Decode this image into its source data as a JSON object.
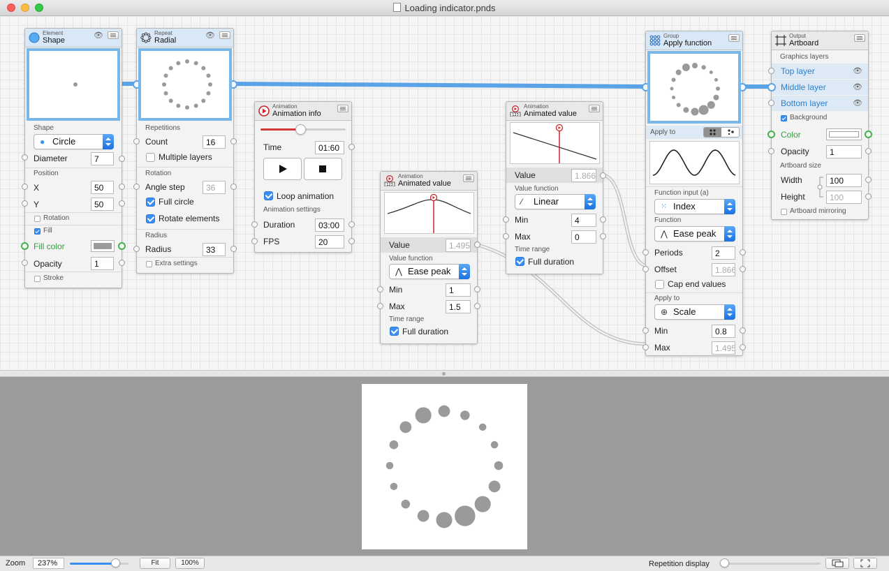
{
  "window": {
    "title": "Loading indicator.pnds"
  },
  "nodes": {
    "shape": {
      "category": "Element",
      "name": "Shape",
      "shape_label": "Shape",
      "shape_value": "Circle",
      "diameter_label": "Diameter",
      "diameter_value": "7",
      "position_label": "Position",
      "x_label": "X",
      "x_value": "50",
      "y_label": "Y",
      "y_value": "50",
      "rotation_label": "Rotation",
      "fill_label": "Fill",
      "fill_color_label": "Fill color",
      "opacity_label": "Opacity",
      "opacity_value": "1",
      "stroke_label": "Stroke"
    },
    "radial": {
      "category": "Repeat",
      "name": "Radial",
      "repetitions_label": "Repetitions",
      "count_label": "Count",
      "count_value": "16",
      "multiple_layers_label": "Multiple layers",
      "rotation_label": "Rotation",
      "angle_step_label": "Angle step",
      "angle_step_value": "36",
      "full_circle_label": "Full circle",
      "rotate_elements_label": "Rotate elements",
      "radius_section_label": "Radius",
      "radius_label": "Radius",
      "radius_value": "33",
      "extra_settings_label": "Extra settings"
    },
    "animation_info": {
      "category": "Animation",
      "name": "Animation info",
      "time_label": "Time",
      "time_value": "01:60",
      "slider_position": 0.47,
      "loop_label": "Loop animation",
      "settings_label": "Animation settings",
      "duration_label": "Duration",
      "duration_value": "03:00",
      "fps_label": "FPS",
      "fps_value": "20"
    },
    "animated_value_1": {
      "category": "Animation",
      "name": "Animated value",
      "value_label": "Value",
      "value_value": "1.495",
      "function_label": "Value function",
      "function_value": "Ease peak",
      "min_label": "Min",
      "min_value": "1",
      "max_label": "Max",
      "max_value": "1.5",
      "time_range_label": "Time range",
      "full_duration_label": "Full duration"
    },
    "animated_value_2": {
      "category": "Animation",
      "name": "Animated value",
      "value_label": "Value",
      "value_value": "1.866",
      "function_label": "Value function",
      "function_value": "Linear",
      "min_label": "Min",
      "min_value": "4",
      "max_label": "Max",
      "max_value": "0",
      "time_range_label": "Time range",
      "full_duration_label": "Full duration"
    },
    "apply_function": {
      "category": "Group",
      "name": "Apply function",
      "apply_to_label": "Apply to",
      "function_input_label": "Function input (a)",
      "function_input_value": "Index",
      "function_label": "Function",
      "function_value": "Ease peak",
      "periods_label": "Periods",
      "periods_value": "2",
      "offset_label": "Offset",
      "offset_value": "1.866",
      "cap_end_label": "Cap end values",
      "apply_to2_label": "Apply to",
      "apply_to2_value": "Scale",
      "min_label": "Min",
      "min_value": "0.8",
      "max_label": "Max",
      "max_value": "1.495"
    },
    "artboard": {
      "category": "Output",
      "name": "Artboard",
      "graphics_layers_label": "Graphics layers",
      "layers": [
        "Top layer",
        "Middle layer",
        "Bottom layer"
      ],
      "background_label": "Background",
      "color_label": "Color",
      "opacity_label": "Opacity",
      "opacity_value": "1",
      "size_label": "Artboard size",
      "width_label": "Width",
      "width_value": "100",
      "height_label": "Height",
      "height_value": "100",
      "mirroring_label": "Artboard mirroring"
    }
  },
  "statusbar": {
    "zoom_label": "Zoom",
    "zoom_value": "237%",
    "fit_label": "Fit",
    "hundred_label": "100%",
    "repetition_label": "Repetition display"
  },
  "colors": {
    "accent": "#78b7ea",
    "wire": "#5aa3e6",
    "red": "#c8262b",
    "green": "#2ea23b"
  }
}
